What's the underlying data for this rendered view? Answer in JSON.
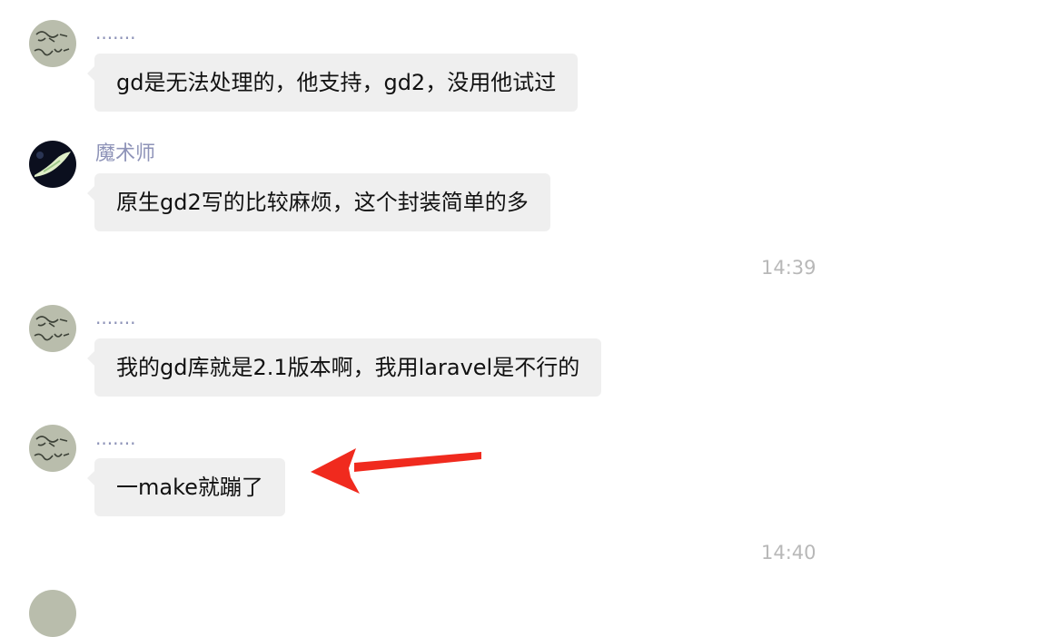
{
  "messages": [
    {
      "sender": "·······",
      "text": "gd是无法处理的，他支持，gd2，没用他试过"
    },
    {
      "sender": "魔术师",
      "text": "原生gd2写的比较麻烦，这个封装简单的多"
    },
    {
      "sender": "·······",
      "text": "我的gd库就是2.1版本啊，我用laravel是不行的"
    },
    {
      "sender": "·······",
      "text": "一make就蹦了"
    }
  ],
  "timestamps": [
    "14:39",
    "14:40"
  ],
  "colors": {
    "bubble": "#efefef",
    "sender_name": "#8e93b8",
    "timestamp": "#b8b8b8",
    "annotation_arrow": "#f02a1e"
  }
}
